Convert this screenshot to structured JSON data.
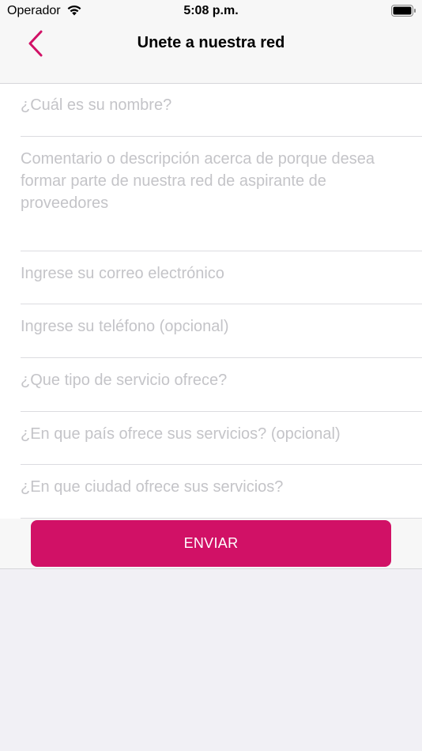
{
  "status_bar": {
    "carrier": "Operador",
    "time": "5:08 p.m."
  },
  "nav": {
    "title": "Unete a nuestra red",
    "back_icon": "chevron-left-icon"
  },
  "form": {
    "fields": [
      {
        "placeholder": "¿Cuál es su nombre?"
      },
      {
        "placeholder": "Comentario o descripción acerca de porque desea formar parte de nuestra red de aspirante de proveedores"
      },
      {
        "placeholder": "Ingrese su correo electrónico"
      },
      {
        "placeholder": "Ingrese su teléfono (opcional)"
      },
      {
        "placeholder": "¿Que tipo de servicio ofrece?"
      },
      {
        "placeholder": "¿En que país ofrece sus servicios? (opcional)"
      },
      {
        "placeholder": "¿En que ciudad ofrece sus servicios?"
      }
    ]
  },
  "submit": {
    "label": "ENVIAR"
  },
  "colors": {
    "accent": "#d11166",
    "placeholder": "#c4c4c8",
    "background": "#f1f0f5"
  }
}
